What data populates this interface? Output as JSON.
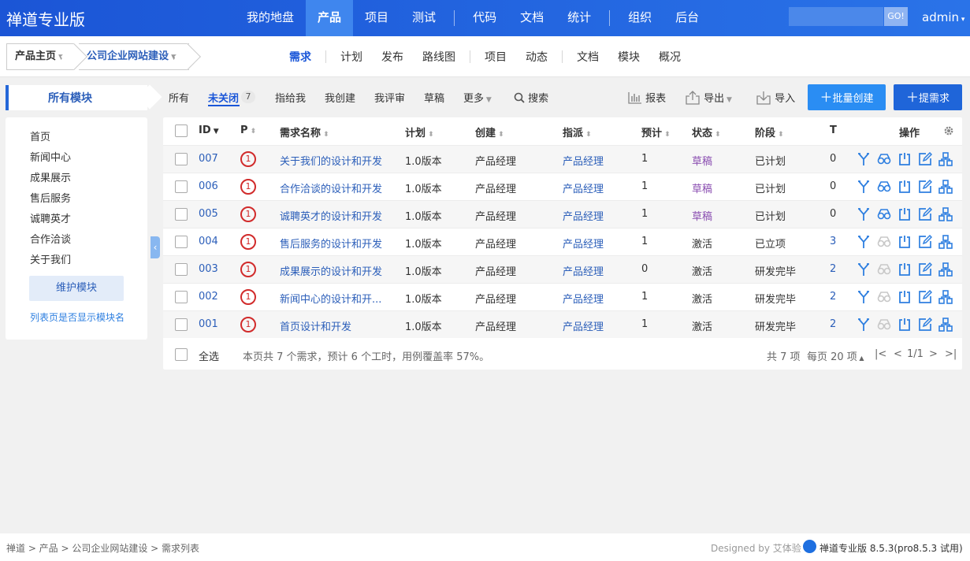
{
  "header": {
    "brand": "禅道专业版",
    "nav": [
      "我的地盘",
      "产品",
      "项目",
      "测试",
      "代码",
      "文档",
      "统计",
      "组织",
      "后台"
    ],
    "active_nav": "产品",
    "search_button": "GO!",
    "user": "admin"
  },
  "subheader": {
    "crumb_home": "产品主页",
    "crumb_product": "公司企业网站建设",
    "nav": [
      "需求",
      "计划",
      "发布",
      "路线图",
      "项目",
      "动态",
      "文档",
      "模块",
      "概况"
    ],
    "active": "需求"
  },
  "sidebar": {
    "title": "所有模块",
    "modules": [
      "首页",
      "新闻中心",
      "成果展示",
      "售后服务",
      "诚聘英才",
      "合作洽谈",
      "关于我们"
    ],
    "maintain_button": "维护模块",
    "show_module_link": "列表页是否显示模块名"
  },
  "filters": {
    "tabs": [
      "所有",
      "未关闭",
      "指给我",
      "我创建",
      "我评审",
      "草稿",
      "更多"
    ],
    "active": "未关闭",
    "unclosed_count": "7",
    "search": "搜索"
  },
  "toolbar": {
    "report": "报表",
    "export": "导出",
    "import": "导入",
    "batch_create": "批量创建",
    "create": "提需求"
  },
  "table": {
    "headers": {
      "id": "ID",
      "pri": "P",
      "name": "需求名称",
      "plan": "计划",
      "creator": "创建",
      "assigned": "指派",
      "estimate": "预计",
      "status": "状态",
      "stage": "阶段",
      "tasks": "T",
      "actions": "操作"
    },
    "rows": [
      {
        "id": "007",
        "pri": "1",
        "name": "关于我们的设计和开发",
        "plan": "1.0版本",
        "creator": "产品经理",
        "assigned": "产品经理",
        "estimate": "1",
        "status": "草稿",
        "stage": "已计划",
        "tasks": "0"
      },
      {
        "id": "006",
        "pri": "1",
        "name": "合作洽谈的设计和开发",
        "plan": "1.0版本",
        "creator": "产品经理",
        "assigned": "产品经理",
        "estimate": "1",
        "status": "草稿",
        "stage": "已计划",
        "tasks": "0"
      },
      {
        "id": "005",
        "pri": "1",
        "name": "诚聘英才的设计和开发",
        "plan": "1.0版本",
        "creator": "产品经理",
        "assigned": "产品经理",
        "estimate": "1",
        "status": "草稿",
        "stage": "已计划",
        "tasks": "0"
      },
      {
        "id": "004",
        "pri": "1",
        "name": "售后服务的设计和开发",
        "plan": "1.0版本",
        "creator": "产品经理",
        "assigned": "产品经理",
        "estimate": "1",
        "status": "激活",
        "stage": "已立项",
        "tasks": "3"
      },
      {
        "id": "003",
        "pri": "1",
        "name": "成果展示的设计和开发",
        "plan": "1.0版本",
        "creator": "产品经理",
        "assigned": "产品经理",
        "estimate": "0",
        "status": "激活",
        "stage": "研发完毕",
        "tasks": "2"
      },
      {
        "id": "002",
        "pri": "1",
        "name": "新闻中心的设计和开...",
        "plan": "1.0版本",
        "creator": "产品经理",
        "assigned": "产品经理",
        "estimate": "1",
        "status": "激活",
        "stage": "研发完毕",
        "tasks": "2"
      },
      {
        "id": "001",
        "pri": "1",
        "name": "首页设计和开发",
        "plan": "1.0版本",
        "creator": "产品经理",
        "assigned": "产品经理",
        "estimate": "1",
        "status": "激活",
        "stage": "研发完毕",
        "tasks": "2"
      }
    ],
    "footer": {
      "select_all": "全选",
      "summary": "本页共 7 个需求，预计 6 个工时，用例覆盖率 57%。",
      "total": "共 7 项",
      "per_page": "每页 20 项",
      "page": "1/1"
    }
  },
  "footer": {
    "breadcrumb": "禅道 > 产品 > 公司企业网站建设 > 需求列表",
    "designed_by": "Designed by 艾体验",
    "version": "禅道专业版 8.5.3(pro8.5.3 试用)"
  },
  "colors": {
    "header": "#1b55d6",
    "accent": "#2b5eb9",
    "priority": "#d12b2b",
    "draft": "#8b4fb1",
    "primary_button": "#1f65d9"
  }
}
